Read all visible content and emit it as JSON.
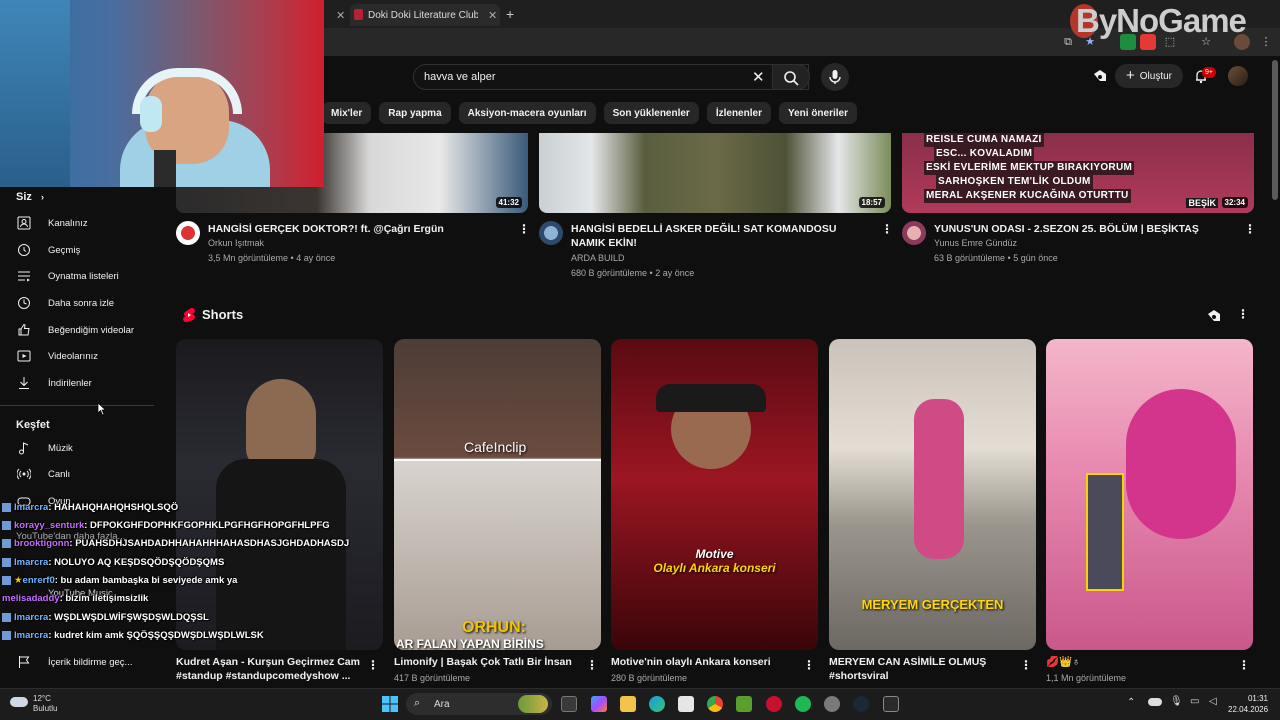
{
  "browser": {
    "tabs": [
      {
        "label": ""
      },
      {
        "label": "Doki Doki Literature Club Türkç"
      }
    ],
    "new_tab": "+"
  },
  "watermark": "ByNoGame",
  "header": {
    "search_value": "havva ve alper",
    "create_label": "Oluştur",
    "notification_badge": "9+"
  },
  "chips": [
    "Mix'ler",
    "Rap yapma",
    "Aksiyon-macera oyunları",
    "Son yüklenenler",
    "İzlenenler",
    "Yeni öneriler"
  ],
  "sidebar": {
    "you_heading": "Siz",
    "you_items": [
      {
        "label": "Kanalınız",
        "icon": "channel-icon"
      },
      {
        "label": "Geçmiş",
        "icon": "history-icon"
      },
      {
        "label": "Oynatma listeleri",
        "icon": "playlist-icon"
      },
      {
        "label": "Daha sonra izle",
        "icon": "clock-icon"
      },
      {
        "label": "Beğendiğim videolar",
        "icon": "like-icon"
      },
      {
        "label": "Videolarınız",
        "icon": "video-icon"
      },
      {
        "label": "İndirilenler",
        "icon": "download-icon"
      }
    ],
    "explore_heading": "Keşfet",
    "explore_items": [
      {
        "label": "Müzik",
        "icon": "music-icon"
      },
      {
        "label": "Canlı",
        "icon": "live-icon"
      },
      {
        "label": "Oyun",
        "icon": "game-icon"
      }
    ],
    "partial_items": [
      "YouTube'dan daha fazla...",
      "YouTube Music",
      "İçerik bildirme geç..."
    ]
  },
  "videos": [
    {
      "title": "HANGİSİ GERÇEK DOKTOR?! ft. @Çağrı Ergün",
      "channel": "Orkun Işıtmak",
      "meta": "3,5 Mn görüntüleme • 4 ay önce",
      "duration": "41:32"
    },
    {
      "title": "HANGİSİ BEDELLİ ASKER DEĞİL! SAT KOMANDOSU NAMIK EKİN!",
      "channel": "ARDA BUILD",
      "meta": "680 B görüntüleme • 2 ay önce",
      "duration": "18:57"
    },
    {
      "title": "YUNUS'UN ODASI - 2.SEZON 25. BÖLÜM | BEŞİKTAŞ",
      "channel": "Yunus Emre Gündüz",
      "meta": "63 B görüntüleme • 5 gün önce",
      "duration": "32:34",
      "overlay_lines": [
        "REISLE CUMA NAMAZI",
        "ESC... KOVALADIM",
        "ESKİ EVLERİME MEKTUP BIRAKIYORUM",
        "SARHOŞKEN TEM'LİK OLDUM",
        "MERAL AKŞENER KUCAĞINA OTURTTU"
      ],
      "badge": "BEŞİK"
    }
  ],
  "shorts": {
    "heading": "Shorts",
    "items": [
      {
        "title": "Kudret Aşan - Kurşun Geçirmez Cam #standup #standupcomedyshow ...",
        "meta": ""
      },
      {
        "title": "Limonify | Başak Çok Tatlı Bir İnsan",
        "meta": "417 B görüntüleme",
        "overlay_top": "CafeInclip",
        "overlay_bottom": "ORHUN:",
        "overlay_sub": "AR FALAN YAPAN BİRİNS"
      },
      {
        "title": "Motive'nin olaylı Ankara konseri",
        "meta": "280 B görüntüleme",
        "overlay_a": "Motive",
        "overlay_b": "Olaylı Ankara konseri"
      },
      {
        "title": "MERYEM CAN ASİMİLE OLMUŞ #shortsviral",
        "meta": "",
        "overlay": "MERYEM GERÇEKTEN"
      },
      {
        "title": "💋👑♁",
        "meta": "1,1 Mn görüntüleme"
      }
    ]
  },
  "chat": [
    {
      "user": "lmarcra",
      "msg": ": HAHAHQHAHQHSHQLSQÖ"
    },
    {
      "user": "korayy_senturk",
      "msg": ": DFPOKGHFDOPHKFGOPHKLPGFHGFHOPGFHLPFG"
    },
    {
      "user": "brooktigonn",
      "msg": ": PUAHSDHJSAHDADHHAHAHHHAHASDHASJGHDADHASDJ"
    },
    {
      "user": "lmarcra",
      "msg": ": NOLUYO AQ KEŞDSQÖDŞQÖDŞQMS"
    },
    {
      "user": "enrerf0",
      "msg": ": bu adam bambaşka bi seviyede amk ya"
    },
    {
      "user": "melisadaddy",
      "msg": ": bizim iletişimsizlik"
    },
    {
      "user": "lmarcra",
      "msg": ": WŞDLWŞDLWİFŞWŞDŞWLDQŞSL"
    },
    {
      "user": "lmarcra",
      "msg": ": kudret kim amk ŞQÖŞŞQŞDWŞDLWŞDLWLSK"
    }
  ],
  "taskbar": {
    "weather_temp": "12°C",
    "weather_desc": "Bulutlu",
    "search_placeholder": "Ara",
    "time": "01:31",
    "date": "22.04.2026"
  }
}
